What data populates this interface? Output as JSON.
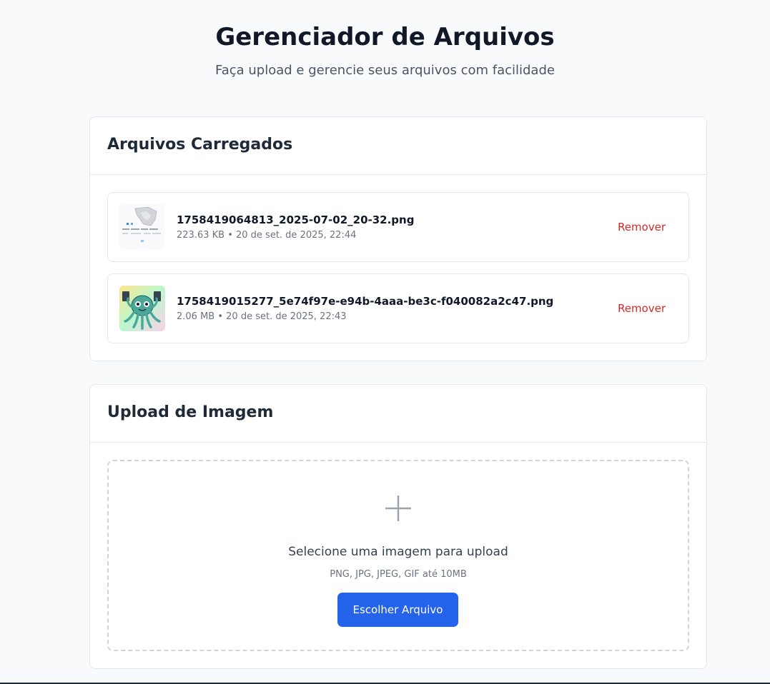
{
  "header": {
    "title": "Gerenciador de Arquivos",
    "subtitle": "Faça upload e gerencie seus arquivos com facilidade"
  },
  "files_section": {
    "title": "Arquivos Carregados",
    "files": [
      {
        "name": "1758419064813_2025-07-02_20-32.png",
        "meta": "223.63 KB • 20 de set. de 2025, 22:44",
        "thumbnail": "map-screenshot-thumbnail",
        "remove_label": "Remover"
      },
      {
        "name": "1758419015277_5e74f97e-e94b-4aaa-be3c-f040082a2c47.png",
        "meta": "2.06 MB • 20 de set. de 2025, 22:43",
        "thumbnail": "octopus-illustration-thumbnail",
        "remove_label": "Remover"
      }
    ]
  },
  "upload_section": {
    "title": "Upload de Imagem",
    "dropzone_title": "Selecione uma imagem para upload",
    "dropzone_hint": "PNG, JPG, JPEG, GIF até 10MB",
    "choose_button": "Escolher Arquivo",
    "icon": "plus-icon"
  },
  "colors": {
    "accent": "#2563eb",
    "danger": "#dc2626",
    "background": "#f8fafc"
  }
}
